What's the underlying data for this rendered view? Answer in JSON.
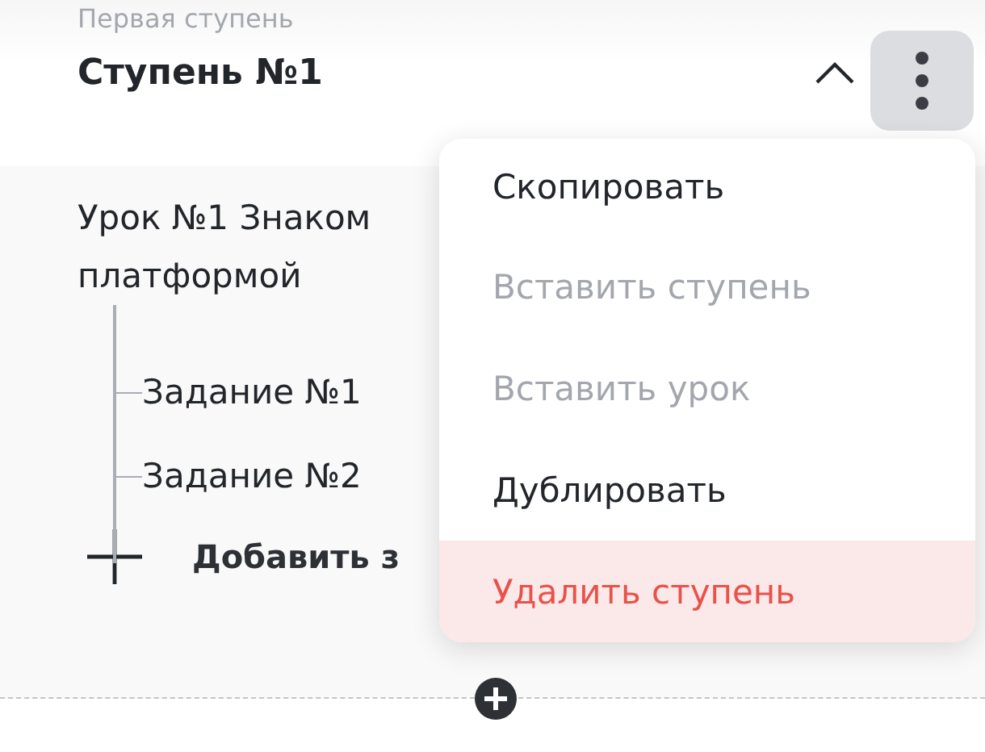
{
  "stage": {
    "subtitle": "Первая ступень",
    "title": "Ступень №1",
    "expanded": true
  },
  "lesson": {
    "title_lines": [
      "Урок №1 Знаком",
      "платформой"
    ],
    "tasks": [
      {
        "label": "Задание №1"
      },
      {
        "label": "Задание №2"
      }
    ],
    "add_label": "Добавить з"
  },
  "menu": {
    "open": true,
    "items": [
      {
        "label": "Скопировать",
        "disabled": false,
        "kind": "normal"
      },
      {
        "label": "Вставить ступень",
        "disabled": true,
        "kind": "normal"
      },
      {
        "label": "Вставить урок",
        "disabled": true,
        "kind": "normal"
      },
      {
        "label": "Дублировать",
        "disabled": false,
        "kind": "normal"
      },
      {
        "label": "Удалить ступень",
        "disabled": false,
        "kind": "danger"
      }
    ]
  }
}
